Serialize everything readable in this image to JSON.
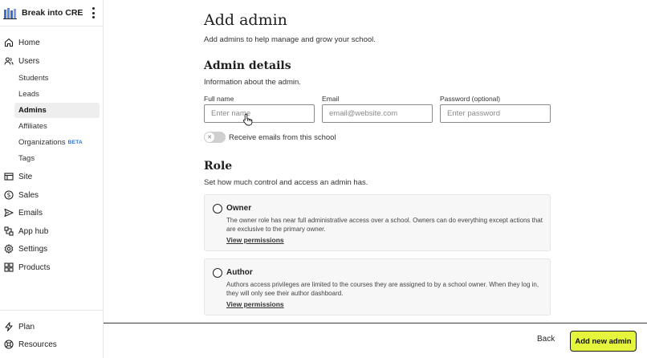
{
  "school": {
    "name": "Break into CRE"
  },
  "nav": {
    "home": "Home",
    "users": "Users",
    "users_sub": [
      {
        "label": "Students"
      },
      {
        "label": "Leads"
      },
      {
        "label": "Admins"
      },
      {
        "label": "Affiliates"
      },
      {
        "label": "Organizations",
        "badge": "BETA"
      },
      {
        "label": "Tags"
      }
    ],
    "site": "Site",
    "sales": "Sales",
    "emails": "Emails",
    "app_hub": "App hub",
    "settings": "Settings",
    "products": "Products",
    "plan": "Plan",
    "resources": "Resources"
  },
  "page": {
    "title": "Add admin",
    "subtitle": "Add admins to help manage and grow your school."
  },
  "details": {
    "title": "Admin details",
    "subtitle": "Information about the admin.",
    "full_name_label": "Full name",
    "full_name_placeholder": "Enter name",
    "email_label": "Email",
    "email_placeholder": "email@website.com",
    "password_label": "Password (optional)",
    "password_placeholder": "Enter password",
    "toggle_label": "Receive emails from this school",
    "toggle_on": false
  },
  "role": {
    "title": "Role",
    "subtitle": "Set how much control and access an admin has.",
    "options": [
      {
        "title": "Owner",
        "description": "The owner role has near full administrative access over a school. Owners can do everything except actions that are exclusive to the primary owner.",
        "link": "View permissions"
      },
      {
        "title": "Author",
        "description": "Authors access privileges are limited to the courses they are assigned to by a school owner. When they log in, they will only see their author dashboard.",
        "link": "View permissions"
      }
    ]
  },
  "footer": {
    "back_label": "Back",
    "submit_label": "Add new admin"
  },
  "colors": {
    "accent": "#e4f53c",
    "beta": "#2b6fd6",
    "active_nav_bg": "#eeeeee"
  }
}
